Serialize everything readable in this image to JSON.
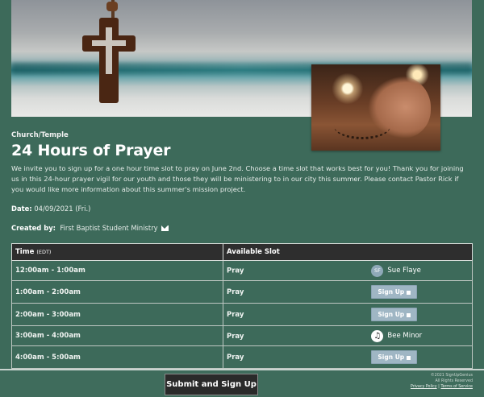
{
  "event": {
    "category": "Church/Temple",
    "title": "24 Hours of Prayer",
    "description": "We invite you to sign up for a one hour time slot to pray on June 2nd. Choose a time slot that works best for you! Thank you for joining us in this 24-hour prayer vigil for our youth and those they will be ministering to in our city this summer. Please contact Pastor Rick if you would like more information about this summer's mission project.",
    "date_label": "Date:",
    "date_value": "04/09/2021 (Fri.)",
    "created_label": "Created by:",
    "created_value": "First Baptist Student Ministry"
  },
  "table": {
    "col_time": "Time",
    "col_time_tz": "(EDT)",
    "col_slot": "Available Slot",
    "rows": [
      {
        "time": "12:00am - 1:00am",
        "slot": "Pray",
        "type": "person",
        "initials": "SF",
        "name": "Sue Flaye"
      },
      {
        "time": "1:00am - 2:00am",
        "slot": "Pray",
        "type": "signup",
        "button": "Sign Up"
      },
      {
        "time": "2:00am - 3:00am",
        "slot": "Pray",
        "type": "signup",
        "button": "Sign Up"
      },
      {
        "time": "3:00am - 4:00am",
        "slot": "Pray",
        "type": "person-icon",
        "name": "Bee Minor"
      },
      {
        "time": "4:00am - 5:00am",
        "slot": "Pray",
        "type": "signup",
        "button": "Sign Up"
      }
    ]
  },
  "footer": {
    "submit_label": "Submit and Sign Up",
    "copyright": "©2021 SignUpGenius",
    "rights": "All Rights Reserved",
    "privacy": "Privacy Policy",
    "sep": "|",
    "terms": "Terms of Service"
  }
}
